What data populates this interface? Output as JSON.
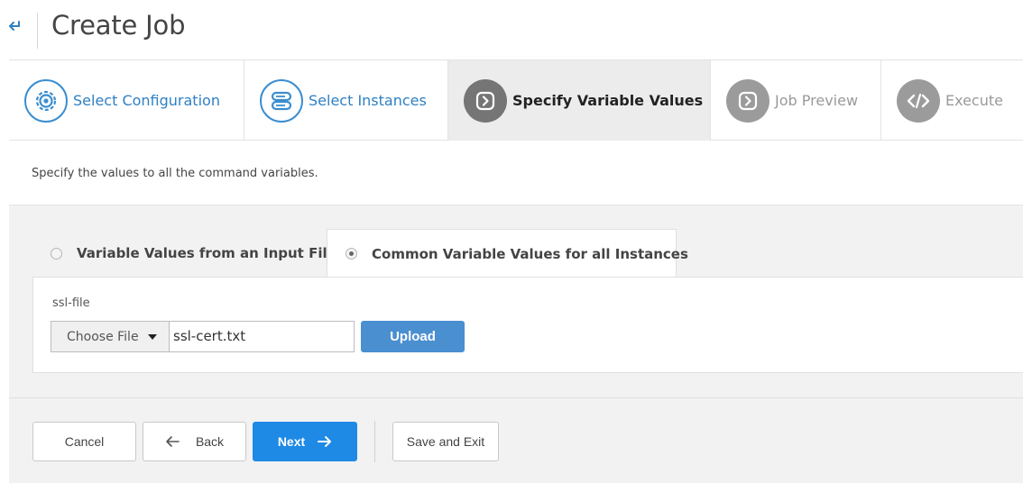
{
  "header": {
    "title": "Create Job",
    "back_icon": "back-arrow-icon"
  },
  "steps": [
    {
      "label": "Select Configuration",
      "icon": "gear-icon",
      "state": "done"
    },
    {
      "label": "Select Instances",
      "icon": "server-icon",
      "state": "done"
    },
    {
      "label": "Specify Variable Values",
      "icon": "chevron-right-icon",
      "state": "active"
    },
    {
      "label": "Job Preview",
      "icon": "chevron-right-icon",
      "state": "future"
    },
    {
      "label": "Execute",
      "icon": "code-icon",
      "state": "future"
    }
  ],
  "instruction": "Specify the values to all the command variables.",
  "variable_options": [
    {
      "label": "Variable Values from an Input File",
      "checked": false
    },
    {
      "label": "Common Variable Values for all Instances",
      "checked": true
    }
  ],
  "form": {
    "field_label": "ssl-file",
    "choose_file_label": "Choose File",
    "file_name": "ssl-cert.txt",
    "upload_label": "Upload"
  },
  "footer": {
    "cancel_label": "Cancel",
    "back_label": "Back",
    "next_label": "Next",
    "save_exit_label": "Save and Exit"
  },
  "colors": {
    "accent_blue": "#1f89e6",
    "upload_blue": "#4a8fd0",
    "done_step_blue": "#2f80c4",
    "active_step_bg": "#ececec"
  }
}
